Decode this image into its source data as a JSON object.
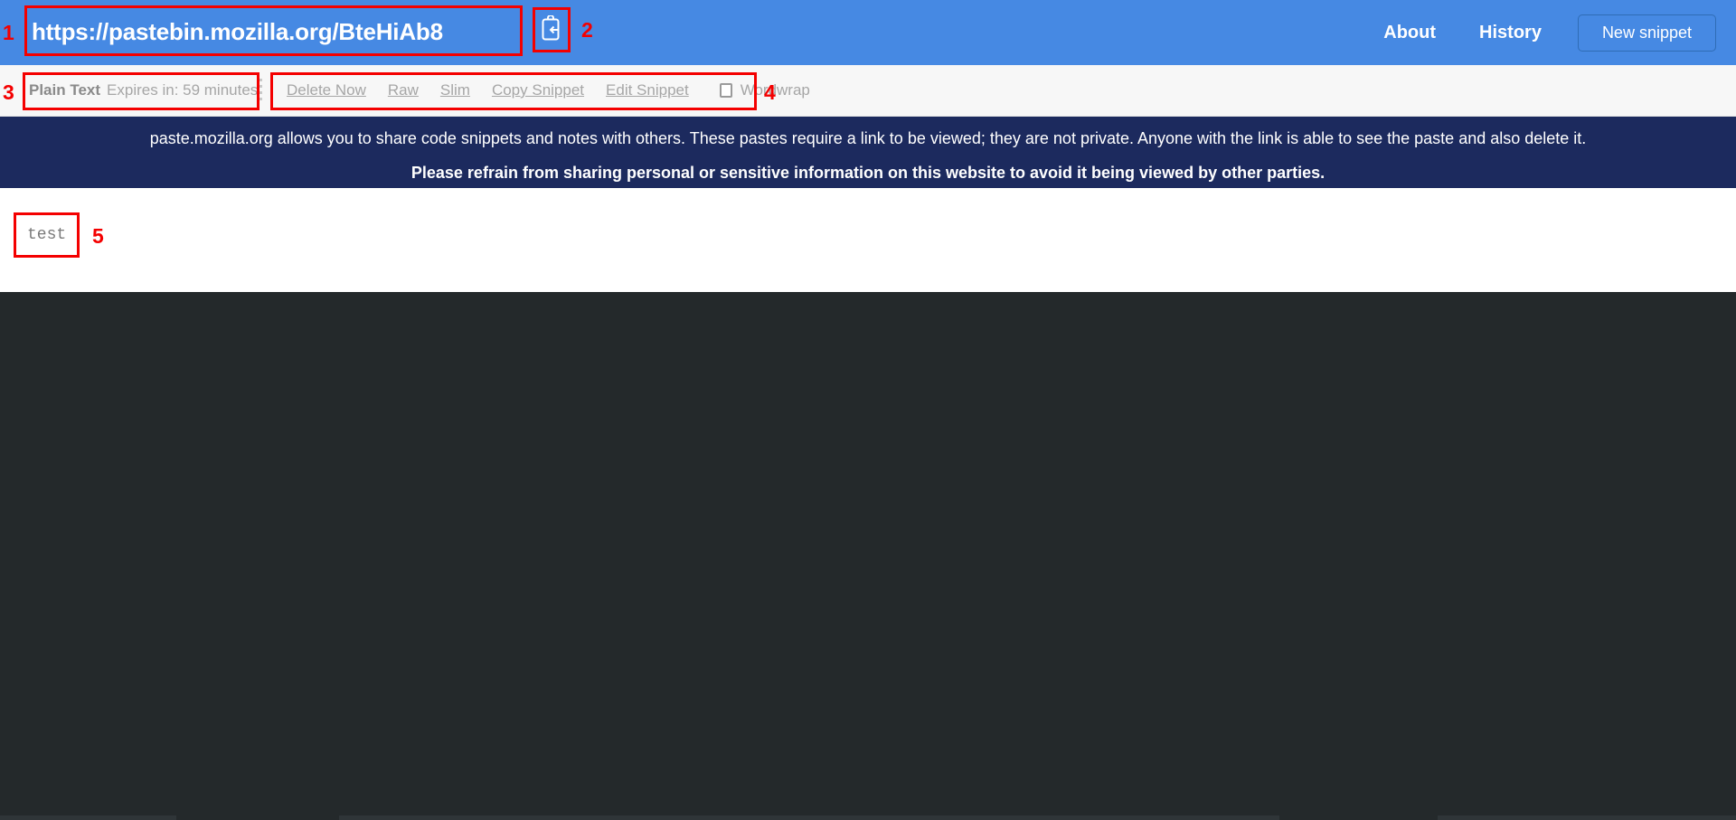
{
  "header": {
    "url": "https://pastebin.mozilla.org/BteHiAb8",
    "paste_icon": "clipboard-paste-icon",
    "nav": [
      {
        "label": "About"
      },
      {
        "label": "History"
      }
    ],
    "new_snippet_label": "New snippet",
    "background_color": "#4689e3"
  },
  "toolbar": {
    "language": "Plain Text",
    "expires": "Expires in: 59 minutes",
    "actions": [
      {
        "label": "Delete Now"
      },
      {
        "label": "Raw"
      },
      {
        "label": "Slim"
      },
      {
        "label": "Copy Snippet"
      },
      {
        "label": "Edit Snippet"
      }
    ],
    "wordwrap_label": "Wordwrap",
    "wordwrap_checked": false,
    "background_color": "#f7f7f7"
  },
  "notice": {
    "line1": "paste.mozilla.org allows you to share code snippets and notes with others. These pastes require a link to be viewed; they are not private. Anyone with the link is able to see the paste and also delete it.",
    "line2": "Please refrain from sharing personal or sensitive information on this website to avoid it being viewed by other parties.",
    "background_color": "#1c2a5e"
  },
  "snippet": {
    "content": "test",
    "background_color": "#ffffff",
    "text_color": "#7a7a7a"
  },
  "page": {
    "dark_background_color": "#24292b"
  },
  "annotations": [
    {
      "number": "1",
      "target": "url-field"
    },
    {
      "number": "2",
      "target": "paste-button"
    },
    {
      "number": "3",
      "target": "metadata-group"
    },
    {
      "number": "4",
      "target": "actions-group"
    },
    {
      "number": "5",
      "target": "snippet-content"
    }
  ]
}
